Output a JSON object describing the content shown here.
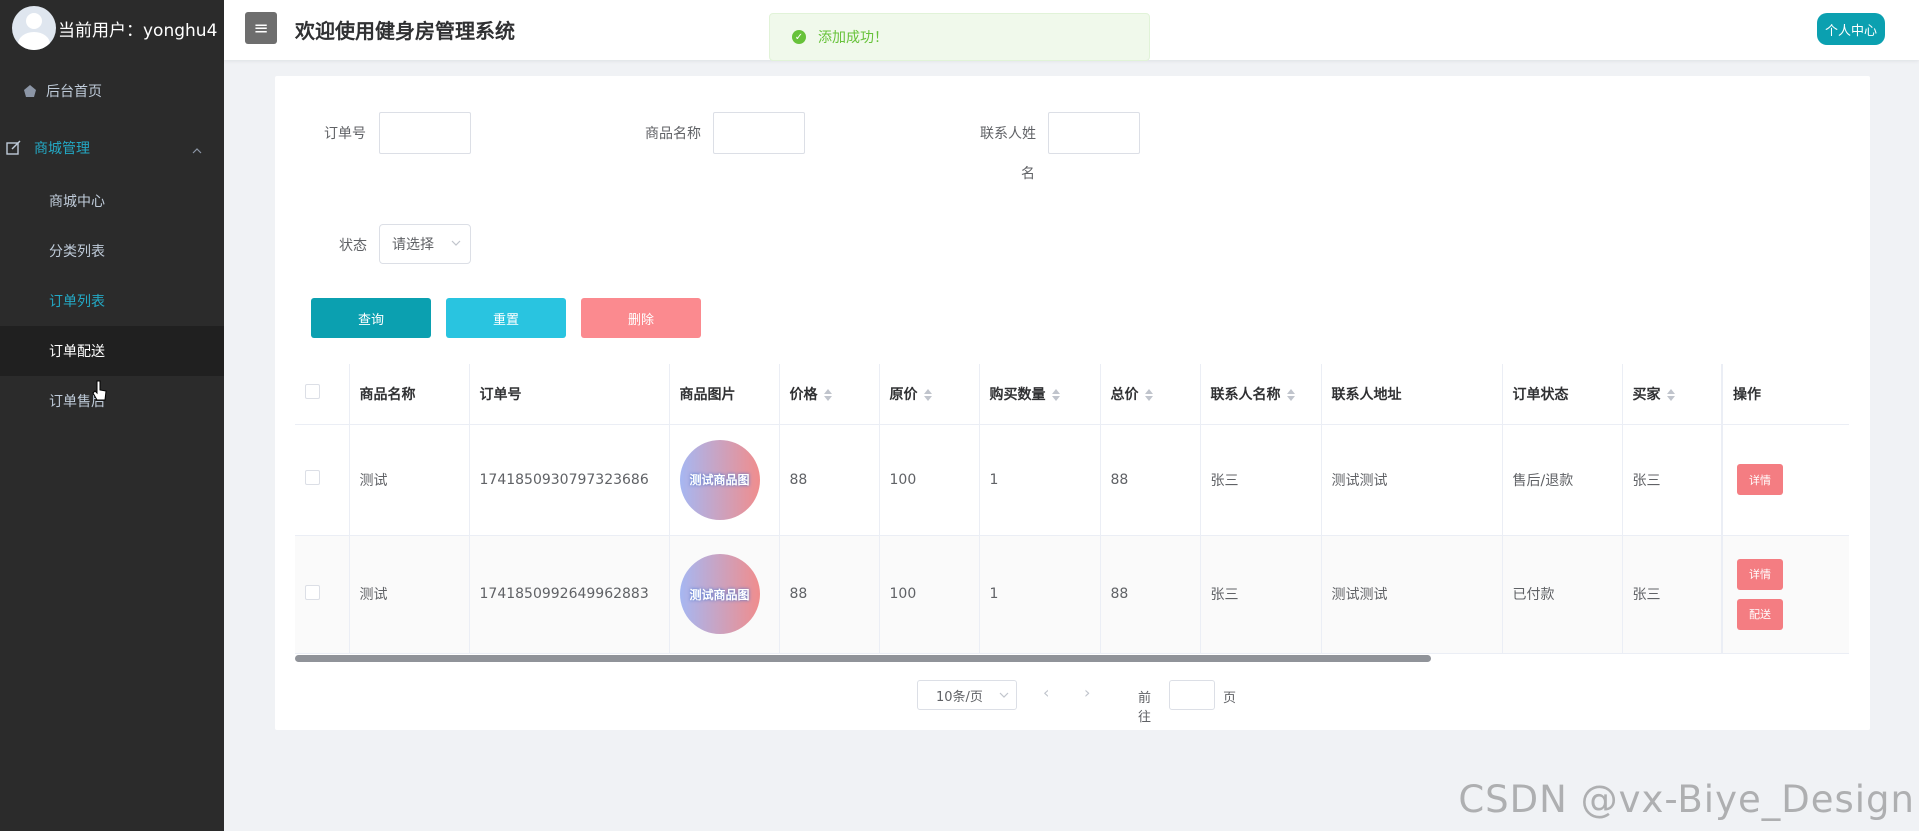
{
  "sidebar": {
    "user_text": "当前用户：yonghu4",
    "home": "后台首页",
    "group": "商城管理",
    "items": [
      "商城中心",
      "分类列表",
      "订单列表",
      "订单配送",
      "订单售后"
    ]
  },
  "header": {
    "title": "欢迎使用健身房管理系统",
    "profile_button": "个人中心"
  },
  "toast": {
    "message": "添加成功！"
  },
  "filters": {
    "order_no_label": "订单号",
    "product_name_label": "商品名称",
    "contact_name_label_line1": "联系人姓",
    "contact_name_label_line2": "名",
    "status_label": "状态",
    "status_placeholder": "请选择"
  },
  "actions": {
    "query": "查询",
    "reset": "重置",
    "delete": "删除"
  },
  "table": {
    "columns": [
      "商品名称",
      "订单号",
      "商品图片",
      "价格",
      "原价",
      "购买数量",
      "总价",
      "联系人名称",
      "联系人地址",
      "订单状态",
      "买家",
      "操作"
    ],
    "image_text": "测试商品图",
    "rows": [
      {
        "name": "测试",
        "order_no": "1741850930797323686",
        "price": "88",
        "original_price": "100",
        "qty": "1",
        "total": "88",
        "contact": "张三",
        "address": "测试测试",
        "status": "售后/退款",
        "buyer": "张三",
        "actions": [
          "详情"
        ]
      },
      {
        "name": "测试",
        "order_no": "1741850992649962883",
        "price": "88",
        "original_price": "100",
        "qty": "1",
        "total": "88",
        "contact": "张三",
        "address": "测试测试",
        "status": "已付款",
        "buyer": "张三",
        "actions": [
          "详情",
          "配送"
        ]
      }
    ]
  },
  "pagination": {
    "page_size": "10条/页",
    "goto_prefix": "前往",
    "goto_suffix": "页"
  },
  "watermark": "CSDN @vx-Biye_Design",
  "colors": {
    "sidebar_bg": "#2b2b2b",
    "accent": "#23a8c4",
    "query_btn": "#0ba0b0",
    "reset_btn": "#29c4e0",
    "delete_btn": "#fb8a8f",
    "row_btn": "#f47d82",
    "success": "#67c23a"
  }
}
